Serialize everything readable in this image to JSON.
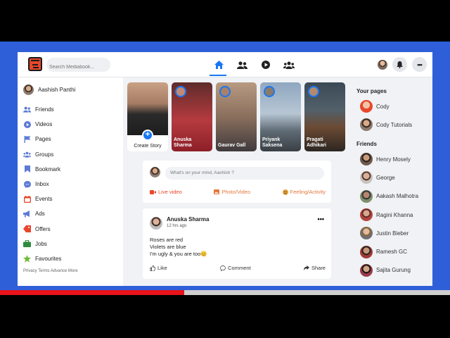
{
  "search": {
    "placeholder": "Search Mediabook..."
  },
  "nav": [
    "home-icon",
    "friends-icon",
    "watch-icon",
    "groups-icon"
  ],
  "user": {
    "name": "Aashish Panthi"
  },
  "sidebar": {
    "items": [
      {
        "label": "Friends",
        "icon": "friends-icon",
        "color": "#5b7bd5"
      },
      {
        "label": "Videos",
        "icon": "video-icon",
        "color": "#5b7bd5"
      },
      {
        "label": "Pages",
        "icon": "flag-icon",
        "color": "#5b7bd5"
      },
      {
        "label": "Groups",
        "icon": "groups-icon",
        "color": "#5b7bd5"
      },
      {
        "label": "Bookmark",
        "icon": "bookmark-icon",
        "color": "#5b7bd5"
      },
      {
        "label": "Inbox",
        "icon": "messenger-icon",
        "color": "#5b7bd5"
      },
      {
        "label": "Events",
        "icon": "calendar-icon",
        "color": "#e8472b"
      },
      {
        "label": "Ads",
        "icon": "megaphone-icon",
        "color": "#5b7bd5"
      },
      {
        "label": "Offers",
        "icon": "tag-icon",
        "color": "#e8472b"
      },
      {
        "label": "Jobs",
        "icon": "briefcase-icon",
        "color": "#2e8b3e"
      },
      {
        "label": "Favourites",
        "icon": "star-icon",
        "color": "#6dbb3a"
      }
    ],
    "footer": "Privacy Terms Advance More"
  },
  "stories": [
    {
      "label": "Create Story"
    },
    {
      "label": "Anuska Sharma"
    },
    {
      "label": "Gaurav Gall"
    },
    {
      "label": "Priyank Saksena"
    },
    {
      "label": "Pragati Adhikari"
    }
  ],
  "composer": {
    "placeholder": "What's on your mind, Aashish ?",
    "live": "Live video",
    "photo": "Photo/Video",
    "feeling": "Feeling/Activity"
  },
  "post": {
    "author": "Anuska Sharma",
    "time": "12 hrs ago",
    "line1": "Roses are red",
    "line2": "Violets are blue",
    "line3": "I'm ugly & you are too",
    "emoji": "😊",
    "like": "Like",
    "comment": "Comment",
    "share": "Share"
  },
  "pages": {
    "title": "Your pages",
    "items": [
      "Cody",
      "Cody Tutorials"
    ]
  },
  "friends": {
    "title": "Friends",
    "items": [
      "Henry Mosely",
      "George",
      "Aakash Malhotra",
      "Ragini Khanna",
      "Justin Bieber",
      "Ramesh GC",
      "Sajita Gurung"
    ]
  },
  "colors": {
    "accent": "#1877f2",
    "background": "#2f5fd8",
    "progress": "#e8131b"
  },
  "video_progress": 0.41
}
